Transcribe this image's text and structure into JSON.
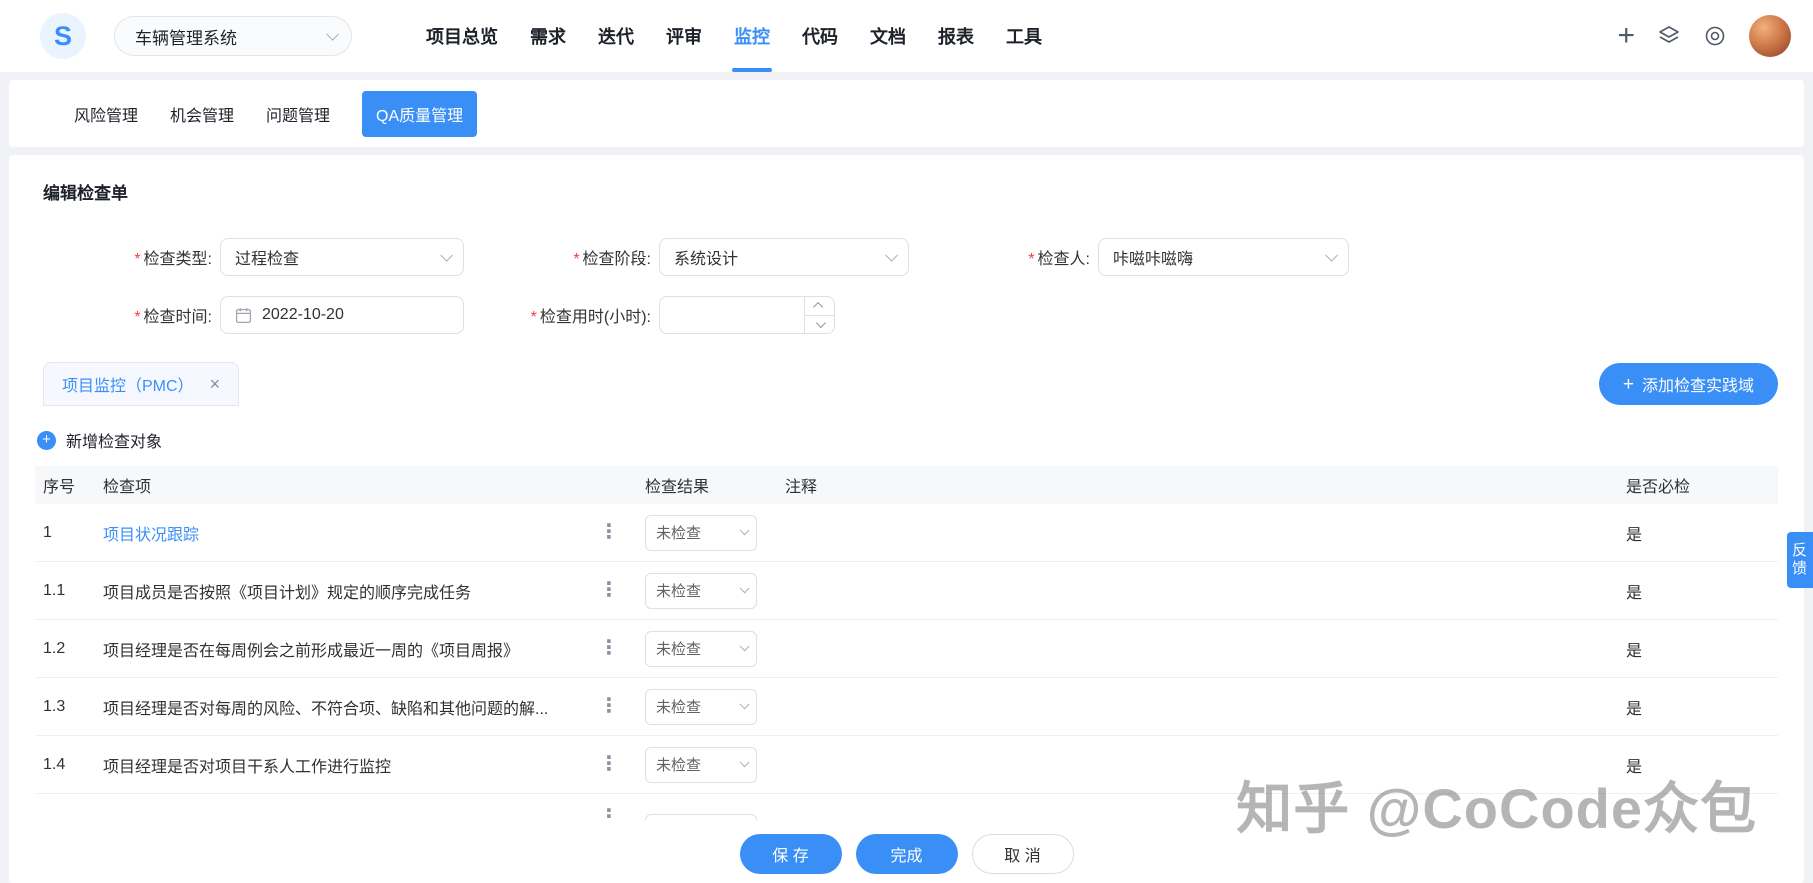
{
  "colors": {
    "primary": "#3a8ff7"
  },
  "icons": {
    "plus": "+",
    "close": "×",
    "kebab": "⋮",
    "logo_letter": "S"
  },
  "header": {
    "project_selector": {
      "value": "车辆管理系统"
    },
    "nav": [
      "项目总览",
      "需求",
      "迭代",
      "评审",
      "监控",
      "代码",
      "文档",
      "报表",
      "工具"
    ],
    "active_nav": "监控"
  },
  "subnav": {
    "tabs": [
      "风险管理",
      "机会管理",
      "问题管理",
      "QA质量管理"
    ],
    "active": "QA质量管理"
  },
  "form": {
    "title": "编辑检查单",
    "required_mark": "*",
    "check_type": {
      "label": "检查类型:",
      "value": "过程检查"
    },
    "check_stage": {
      "label": "检查阶段:",
      "value": "系统设计"
    },
    "checker": {
      "label": "检查人:",
      "value": "咔嗞咔嗞嗨"
    },
    "check_date": {
      "label": "检查时间:",
      "value": "2022-10-20"
    },
    "check_hours": {
      "label": "检查用时(小时):",
      "value": ""
    }
  },
  "practice": {
    "tab_label": "项目监控（PMC）",
    "add_button": "添加检查实践域",
    "add_object": "新增检查对象"
  },
  "table": {
    "headers": [
      "序号",
      "检查项",
      "检查结果",
      "注释",
      "是否必检"
    ],
    "rows": [
      {
        "no": "1",
        "item": "项目状况跟踪",
        "result": "未检查",
        "required": "是"
      },
      {
        "no": "1.1",
        "item": "项目成员是否按照《项目计划》规定的顺序完成任务",
        "result": "未检查",
        "required": "是"
      },
      {
        "no": "1.2",
        "item": "项目经理是否在每周例会之前形成最近一周的《项目周报》",
        "result": "未检查",
        "required": "是"
      },
      {
        "no": "1.3",
        "item": "项目经理是否对每周的风险、不符合项、缺陷和其他问题的解...",
        "result": "未检查",
        "required": "是"
      },
      {
        "no": "1.4",
        "item": "项目经理是否对项目干系人工作进行监控",
        "result": "未检查",
        "required": "是"
      }
    ]
  },
  "footer": {
    "save": "保 存",
    "complete": "完成",
    "cancel": "取 消"
  },
  "feedback": "反馈",
  "watermark": "知乎 @CoCode众包"
}
